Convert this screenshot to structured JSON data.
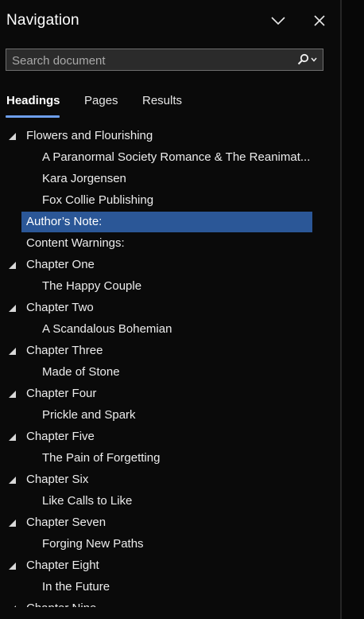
{
  "pane": {
    "title": "Navigation"
  },
  "search": {
    "placeholder": "Search document"
  },
  "tabs": [
    {
      "label": "Headings",
      "active": true
    },
    {
      "label": "Pages",
      "active": false
    },
    {
      "label": "Results",
      "active": false
    }
  ],
  "headings": [
    {
      "text": "Flowers and Flourishing",
      "level": 1,
      "expandable": true,
      "selected": false
    },
    {
      "text": "A Paranormal Society Romance & The Reanimat...",
      "level": 2,
      "expandable": false,
      "selected": false
    },
    {
      "text": "Kara Jorgensen",
      "level": 2,
      "expandable": false,
      "selected": false
    },
    {
      "text": "Fox Collie Publishing",
      "level": 2,
      "expandable": false,
      "selected": false
    },
    {
      "text": "Author’s Note:",
      "level": 1,
      "expandable": false,
      "selected": true
    },
    {
      "text": "Content Warnings:",
      "level": 1,
      "expandable": false,
      "selected": false
    },
    {
      "text": "Chapter One",
      "level": 1,
      "expandable": true,
      "selected": false
    },
    {
      "text": "The Happy Couple",
      "level": 2,
      "expandable": false,
      "selected": false
    },
    {
      "text": "Chapter Two",
      "level": 1,
      "expandable": true,
      "selected": false
    },
    {
      "text": "A Scandalous Bohemian",
      "level": 2,
      "expandable": false,
      "selected": false
    },
    {
      "text": "Chapter Three",
      "level": 1,
      "expandable": true,
      "selected": false
    },
    {
      "text": "Made of Stone",
      "level": 2,
      "expandable": false,
      "selected": false
    },
    {
      "text": "Chapter Four",
      "level": 1,
      "expandable": true,
      "selected": false
    },
    {
      "text": "Prickle and Spark",
      "level": 2,
      "expandable": false,
      "selected": false
    },
    {
      "text": "Chapter Five",
      "level": 1,
      "expandable": true,
      "selected": false
    },
    {
      "text": "The Pain of Forgetting",
      "level": 2,
      "expandable": false,
      "selected": false
    },
    {
      "text": "Chapter Six",
      "level": 1,
      "expandable": true,
      "selected": false
    },
    {
      "text": "Like Calls to Like",
      "level": 2,
      "expandable": false,
      "selected": false
    },
    {
      "text": "Chapter Seven",
      "level": 1,
      "expandable": true,
      "selected": false
    },
    {
      "text": "Forging New Paths",
      "level": 2,
      "expandable": false,
      "selected": false
    },
    {
      "text": "Chapter Eight",
      "level": 1,
      "expandable": true,
      "selected": false
    },
    {
      "text": "In the Future",
      "level": 2,
      "expandable": false,
      "selected": false
    },
    {
      "text": "Chapter Nine",
      "level": 1,
      "expandable": true,
      "selected": false
    }
  ],
  "colors": {
    "selection": "#2b5797",
    "tab_accent": "#6d9eeb"
  }
}
